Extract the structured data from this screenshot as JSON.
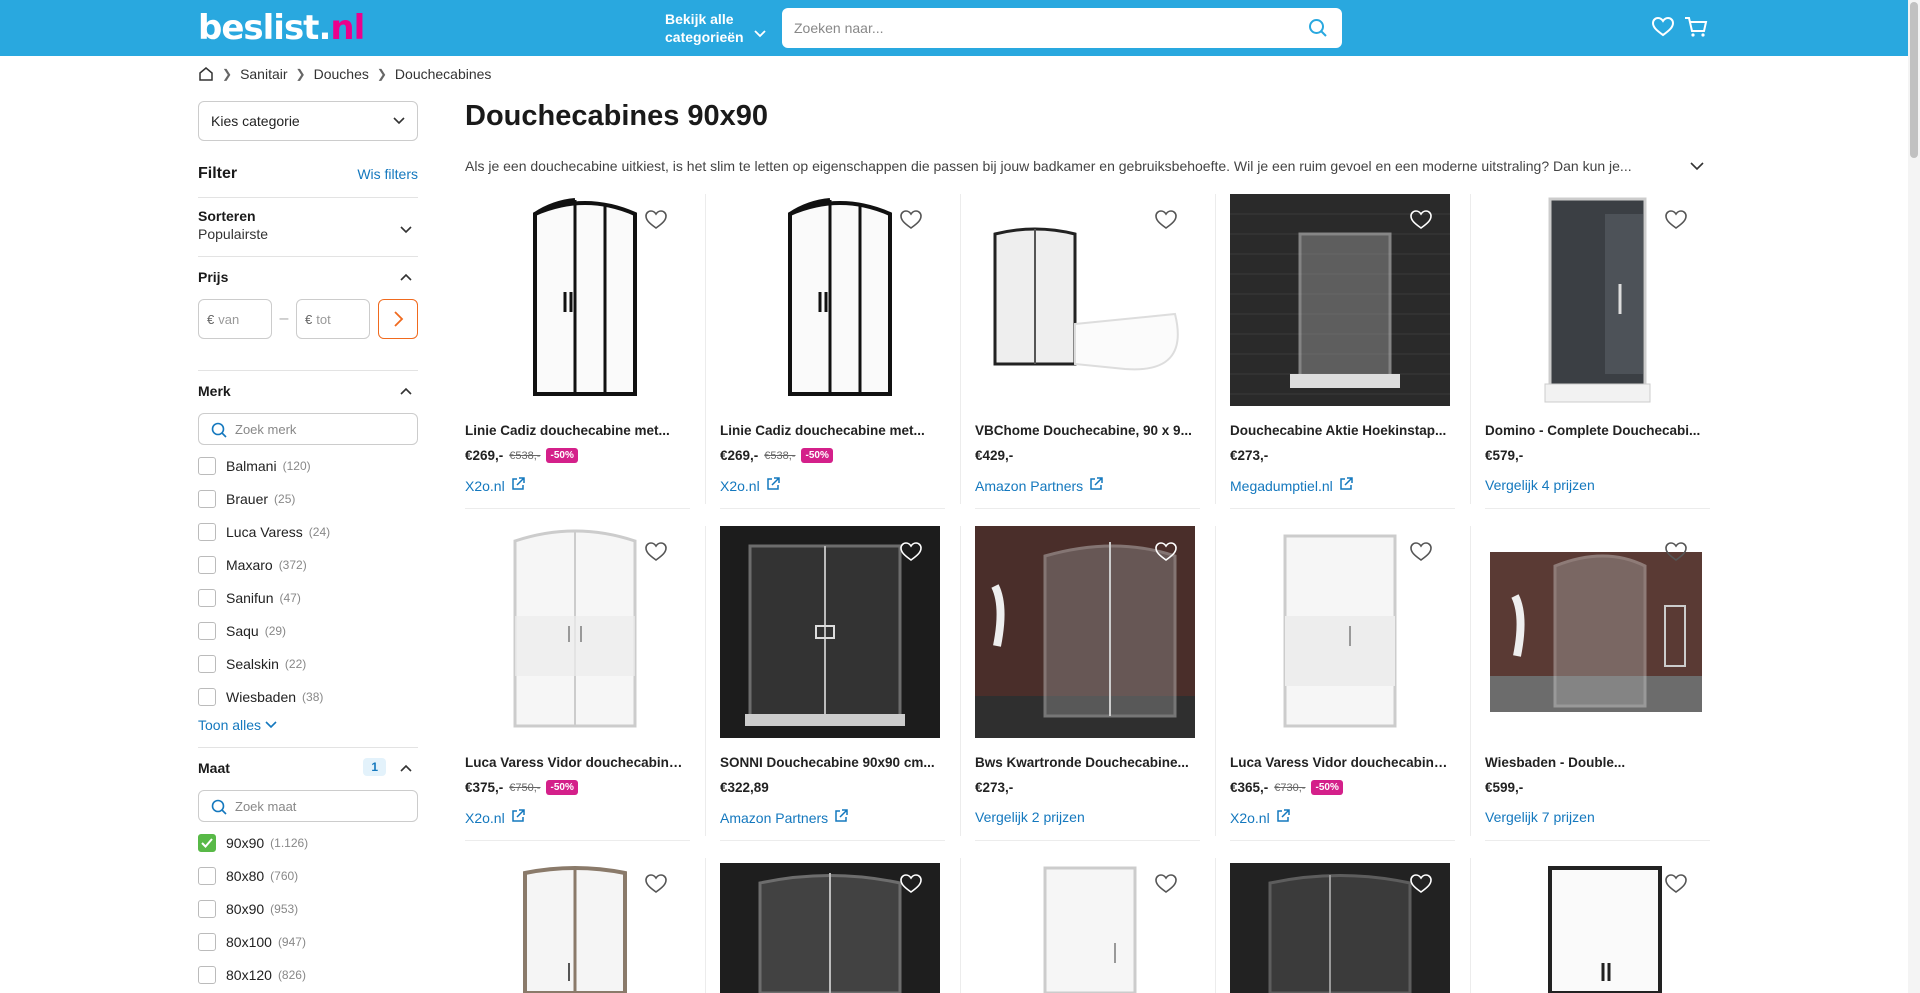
{
  "header": {
    "logo_main": "beslist",
    "logo_dot": ".",
    "logo_tld": "nl",
    "categories_line1": "Bekijk alle",
    "categories_line2": "categorieën",
    "search_placeholder": "Zoeken naar...",
    "brand_color": "#29a8df"
  },
  "breadcrumb": [
    "Sanitair",
    "Douches",
    "Douchecabines"
  ],
  "sidebar": {
    "category_select": "Kies categorie",
    "filter_title": "Filter",
    "clear_filters": "Wis filters",
    "sort_label": "Sorteren",
    "sort_value": "Populairste",
    "price_title": "Prijs",
    "price_from_placeholder": "van",
    "price_to_placeholder": "tot",
    "currency": "€",
    "brand_title": "Merk",
    "brand_search_placeholder": "Zoek merk",
    "brands": [
      {
        "label": "Balmani",
        "count": "(120)"
      },
      {
        "label": "Brauer",
        "count": "(25)"
      },
      {
        "label": "Luca Varess",
        "count": "(24)"
      },
      {
        "label": "Maxaro",
        "count": "(372)"
      },
      {
        "label": "Sanifun",
        "count": "(47)"
      },
      {
        "label": "Saqu",
        "count": "(29)"
      },
      {
        "label": "Sealskin",
        "count": "(22)"
      },
      {
        "label": "Wiesbaden",
        "count": "(38)"
      }
    ],
    "show_all": "Toon alles",
    "size_title": "Maat",
    "size_active_count": "1",
    "size_search_placeholder": "Zoek maat",
    "sizes": [
      {
        "label": "90x90",
        "count": "(1.126)",
        "checked": true
      },
      {
        "label": "80x80",
        "count": "(760)",
        "checked": false
      },
      {
        "label": "80x90",
        "count": "(953)",
        "checked": false
      },
      {
        "label": "80x100",
        "count": "(947)",
        "checked": false
      },
      {
        "label": "80x120",
        "count": "(826)",
        "checked": false
      }
    ]
  },
  "main": {
    "title": "Douchecabines 90x90",
    "intro": "Als je een douchecabine uitkiest, is het slim te letten op eigenschappen die passen bij jouw badkamer en gebruiksbehoefte. Wil je een ruim gevoel en een moderne uitstraling? Dan kun je...",
    "products": [
      {
        "title": "Linie Cadiz douchecabine met...",
        "price": "€269,-",
        "old": "€538,-",
        "discount": "-50%",
        "shop": "X2o.nl",
        "external": true
      },
      {
        "title": "Linie Cadiz douchecabine met...",
        "price": "€269,-",
        "old": "€538,-",
        "discount": "-50%",
        "shop": "X2o.nl",
        "external": true
      },
      {
        "title": "VBChome Douchecabine, 90 x 9...",
        "price": "€429,-",
        "old": "",
        "discount": "",
        "shop": "Amazon Partners",
        "external": true
      },
      {
        "title": "Douchecabine Aktie Hoekinstap...",
        "price": "€273,-",
        "old": "",
        "discount": "",
        "shop": "Megadumptiel.nl",
        "external": true
      },
      {
        "title": "Domino - Complete Douchecabi...",
        "price": "€579,-",
        "old": "",
        "discount": "",
        "shop": "Vergelijk 4 prijzen",
        "external": false
      },
      {
        "title": "Luca Varess Vidor douchecabine...",
        "price": "€375,-",
        "old": "€750,-",
        "discount": "-50%",
        "shop": "X2o.nl",
        "external": true
      },
      {
        "title": "SONNI Douchecabine 90x90 cm...",
        "price": "€322,89",
        "old": "",
        "discount": "",
        "shop": "Amazon Partners",
        "external": true
      },
      {
        "title": "Bws Kwartronde Douchecabine...",
        "price": "€273,-",
        "old": "",
        "discount": "",
        "shop": "Vergelijk 2 prijzen",
        "external": false
      },
      {
        "title": "Luca Varess Vidor douchecabine...",
        "price": "€365,-",
        "old": "€730,-",
        "discount": "-50%",
        "shop": "X2o.nl",
        "external": true
      },
      {
        "title": "Wiesbaden - Double...",
        "price": "€599,-",
        "old": "",
        "discount": "",
        "shop": "Vergelijk 7 prijzen",
        "external": false
      }
    ]
  }
}
